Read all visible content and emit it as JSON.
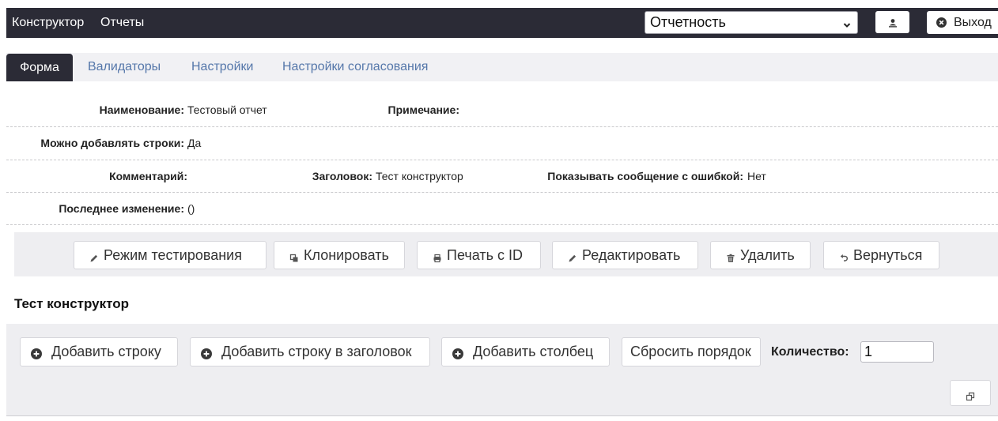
{
  "top_nav": {
    "links": [
      {
        "label": "Конструктор"
      },
      {
        "label": "Отчеты"
      }
    ],
    "report_select": {
      "value": "Отчетность",
      "icon": "chevron-down-icon"
    },
    "user_button": {
      "icon": "user-icon"
    },
    "logout": {
      "label": "Выход",
      "icon": "times-circle-icon"
    }
  },
  "tabs": [
    {
      "label": "Форма",
      "active": true
    },
    {
      "label": "Валидаторы",
      "active": false
    },
    {
      "label": "Настройки",
      "active": false
    },
    {
      "label": "Настройки согласования",
      "active": false
    }
  ],
  "form_info": {
    "name": {
      "label": "Наименование:",
      "value": "Тестовый отчет"
    },
    "note": {
      "label": "Примечание:"
    },
    "can_add_rows": {
      "label": "Можно добавлять строки:",
      "value": "Да"
    },
    "comment": {
      "label": "Комментарий:"
    },
    "header": {
      "label": "Заголовок:",
      "value": "Тест конструктор"
    },
    "show_error_message": {
      "label": "Показывать сообщение с ошибкой:",
      "value": "Нет"
    },
    "last_modified": {
      "label": "Последнее изменение:",
      "value": "()"
    }
  },
  "actions": [
    {
      "label": "Режим тестирования",
      "icon": "pencil-icon"
    },
    {
      "label": "Клонировать",
      "icon": "clone-icon"
    },
    {
      "label": "Печать с ID",
      "icon": "print-icon"
    },
    {
      "label": "Редактировать",
      "icon": "pencil-icon"
    },
    {
      "label": "Удалить",
      "icon": "trash-icon"
    },
    {
      "label": "Вернуться",
      "icon": "undo-icon"
    }
  ],
  "constructor": {
    "title": "Тест конструктор",
    "buttons": [
      {
        "label": "Добавить строку",
        "icon": "plus-circle-icon"
      },
      {
        "label": "Добавить строку в заголовок",
        "icon": "plus-circle-icon"
      },
      {
        "label": "Добавить столбец",
        "icon": "plus-circle-icon"
      },
      {
        "label": "Сбросить порядок"
      }
    ],
    "quantity": {
      "label": "Количество:",
      "value": "1"
    },
    "view_button_icon": "window-restore-icon"
  },
  "colors": {
    "navbar": "#2b2b36",
    "active_tab": "#2b2b36",
    "tab_link": "#5577aa",
    "panel": "#eeeef1",
    "tabbar": "#f1f1f4"
  }
}
